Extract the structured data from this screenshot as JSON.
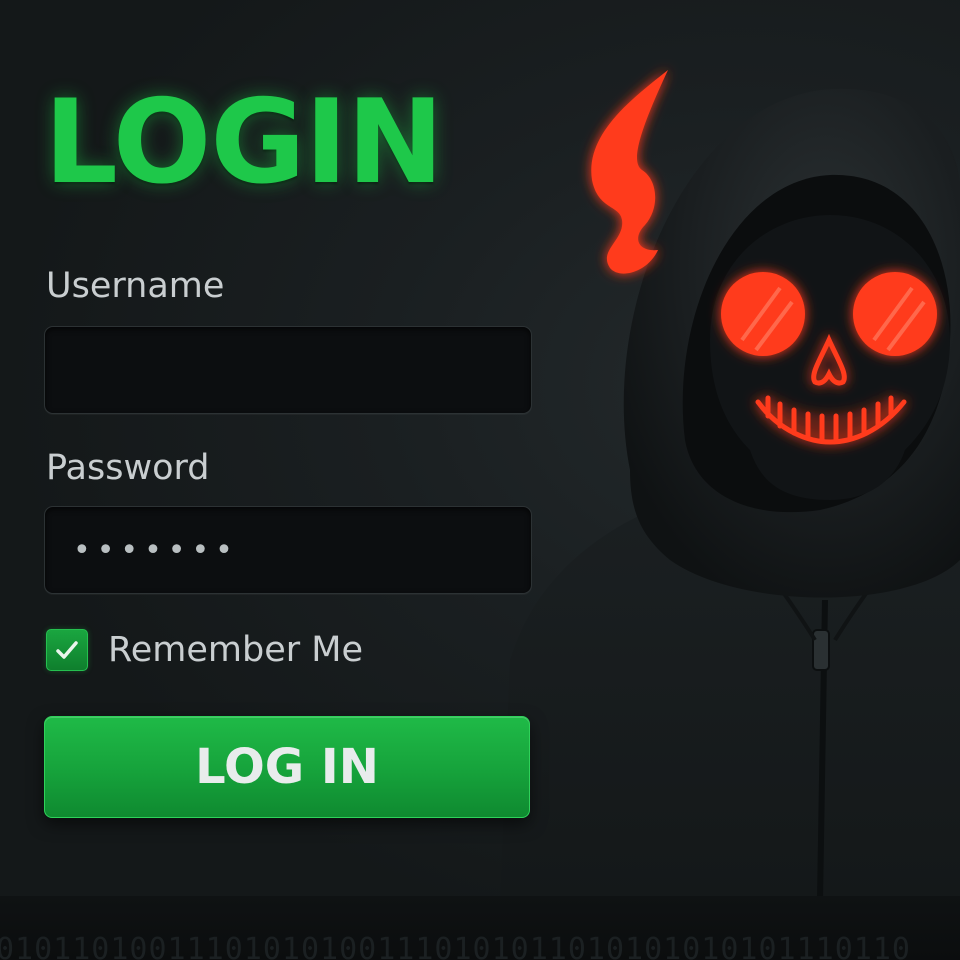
{
  "login": {
    "title": "LOGIN",
    "username_label": "Username",
    "username_value": "",
    "password_label": "Password",
    "password_masked": "•••••••",
    "remember_label": "Remember Me",
    "remember_checked": true,
    "button_label": "LOG IN"
  },
  "footer": {
    "binary": "010110100111010101001110101011010101010101110110"
  },
  "icons": {
    "checkbox": "checkmark-icon",
    "hero": "hooded-skull-icon",
    "flame": "flame-icon"
  },
  "colors": {
    "accent_green": "#1ec84a",
    "button_green": "#16a23b",
    "glow_red": "#ff3a1e",
    "background": "#15191b"
  }
}
